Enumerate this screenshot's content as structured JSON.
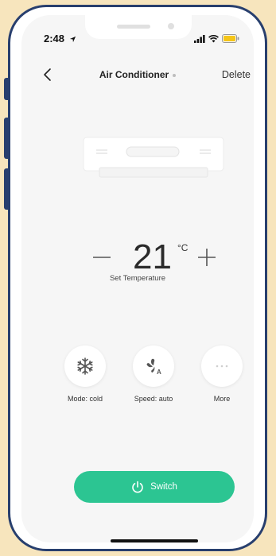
{
  "status_bar": {
    "time": "2:48",
    "location_icon": "location-arrow-icon",
    "signal_icon": "cellular-signal-icon",
    "wifi_icon": "wifi-icon",
    "battery_icon": "battery-icon",
    "battery_color": "#f5c518"
  },
  "header": {
    "back_icon": "chevron-left-icon",
    "title": "Air Conditioner",
    "delete_label": "Delete"
  },
  "device": {
    "image_icon": "air-conditioner-unit-icon"
  },
  "temperature": {
    "value": "21",
    "unit": "°C",
    "label": "Set Temperature",
    "decrease_icon": "minus-icon",
    "increase_icon": "plus-icon"
  },
  "controls": [
    {
      "label": "Mode: cold",
      "icon": "snowflake-icon"
    },
    {
      "label": "Speed: auto",
      "icon": "fan-auto-icon"
    },
    {
      "label": "More",
      "icon": "more-dots-icon"
    }
  ],
  "power": {
    "label": "Switch",
    "icon": "power-icon",
    "color": "#2cc592"
  },
  "colors": {
    "frame": "#283f6e",
    "background": "#f7e5bd",
    "screen": "#f6f6f6"
  }
}
